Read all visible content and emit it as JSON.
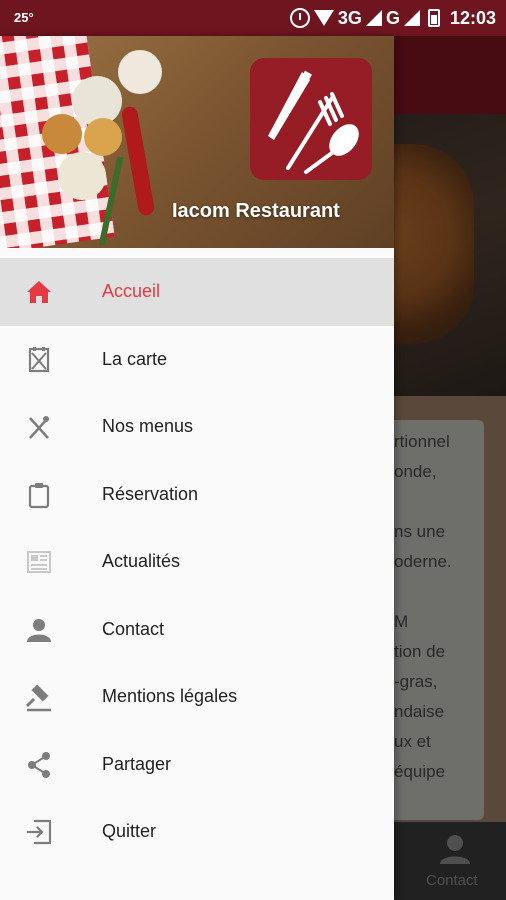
{
  "status_bar": {
    "temperature": "25°",
    "network_3g": "3G",
    "network_g": "G",
    "time": "12:03"
  },
  "drawer": {
    "app_name": "Iacom Restaurant",
    "items": [
      {
        "label": "Accueil",
        "icon": "home-icon",
        "active": true
      },
      {
        "label": "La carte",
        "icon": "menu-card-icon",
        "active": false
      },
      {
        "label": "Nos menus",
        "icon": "utensils-icon",
        "active": false
      },
      {
        "label": "Réservation",
        "icon": "clipboard-icon",
        "active": false
      },
      {
        "label": "Actualités",
        "icon": "newspaper-icon",
        "active": false
      },
      {
        "label": "Contact",
        "icon": "person-icon",
        "active": false
      },
      {
        "label": "Mentions légales",
        "icon": "gavel-icon",
        "active": false
      },
      {
        "label": "Partager",
        "icon": "share-icon",
        "active": false
      },
      {
        "label": "Quitter",
        "icon": "exit-icon",
        "active": false
      }
    ]
  },
  "background": {
    "content_lines": [
      "rtionnel",
      "onde,",
      "",
      "ns une",
      "oderne.",
      "",
      "M",
      "tion de",
      "-gras,",
      "ndaise",
      "ux et",
      "équipe"
    ],
    "bottom_nav_label": "Contact"
  },
  "colors": {
    "status_bar": "#6f1520",
    "toolbar": "#6e111c",
    "logo": "#961c25",
    "active_item": "#e53a44"
  }
}
